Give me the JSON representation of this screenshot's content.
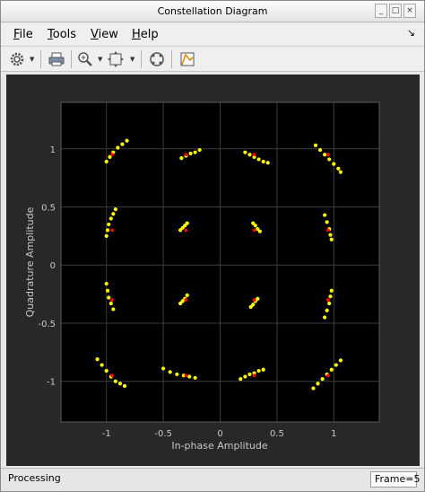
{
  "window": {
    "title": "Constellation Diagram"
  },
  "menu": {
    "items": [
      {
        "label": "File",
        "underline": "F",
        "rest": "ile"
      },
      {
        "label": "Tools",
        "underline": "T",
        "rest": "ools"
      },
      {
        "label": "View",
        "underline": "V",
        "rest": "iew"
      },
      {
        "label": "Help",
        "underline": "H",
        "rest": "elp"
      }
    ]
  },
  "toolbar": {
    "icons": [
      "gear-icon",
      "print-icon",
      "zoom-in-icon",
      "fit-view-icon",
      "constellation-icon",
      "measurement-icon"
    ]
  },
  "status": {
    "text": "Processing",
    "frame": "Frame=5"
  },
  "chart_data": {
    "type": "scatter",
    "title": "",
    "xlabel": "In-phase Amplitude",
    "ylabel": "Quadrature Amplitude",
    "xlim": [
      -1.4,
      1.4
    ],
    "ylim": [
      -1.35,
      1.4
    ],
    "xticks": [
      -1,
      -0.5,
      0,
      0.5,
      1
    ],
    "xtick_labels": [
      "-1",
      "-0.5",
      "0",
      "0.5",
      "1"
    ],
    "yticks": [
      -1,
      -0.5,
      0,
      0.5,
      1
    ],
    "ytick_labels": [
      "-1",
      "-0.5",
      "0",
      "0.5",
      "1"
    ],
    "grid": true,
    "colors": {
      "received": "#ffff00",
      "reference": "#ff0000",
      "plot_bg": "#000000"
    },
    "series": [
      {
        "values": [
          [
            -1.0,
            0.89
          ],
          [
            -0.97,
            0.93
          ],
          [
            -0.94,
            0.97
          ],
          [
            -0.9,
            1.01
          ],
          [
            -0.86,
            1.04
          ],
          [
            -0.82,
            1.07
          ],
          [
            -0.34,
            0.92
          ],
          [
            -0.3,
            0.94
          ],
          [
            -0.26,
            0.96
          ],
          [
            -0.22,
            0.97
          ],
          [
            -0.18,
            0.99
          ],
          [
            0.22,
            0.97
          ],
          [
            0.26,
            0.95
          ],
          [
            0.3,
            0.93
          ],
          [
            0.34,
            0.91
          ],
          [
            0.38,
            0.89
          ],
          [
            0.42,
            0.88
          ],
          [
            0.84,
            1.03
          ],
          [
            0.88,
            0.99
          ],
          [
            0.92,
            0.95
          ],
          [
            0.96,
            0.91
          ],
          [
            1.0,
            0.87
          ],
          [
            1.04,
            0.83
          ],
          [
            1.06,
            0.8
          ],
          [
            -1.0,
            0.25
          ],
          [
            -0.99,
            0.3
          ],
          [
            -0.98,
            0.35
          ],
          [
            -0.96,
            0.4
          ],
          [
            -0.94,
            0.44
          ],
          [
            -0.92,
            0.48
          ],
          [
            -0.35,
            0.3
          ],
          [
            -0.33,
            0.32
          ],
          [
            -0.31,
            0.34
          ],
          [
            -0.29,
            0.36
          ],
          [
            0.29,
            0.36
          ],
          [
            0.31,
            0.34
          ],
          [
            0.33,
            0.31
          ],
          [
            0.35,
            0.29
          ],
          [
            0.92,
            0.43
          ],
          [
            0.94,
            0.37
          ],
          [
            0.96,
            0.31
          ],
          [
            0.97,
            0.26
          ],
          [
            0.98,
            0.22
          ],
          [
            -1.0,
            -0.16
          ],
          [
            -0.99,
            -0.22
          ],
          [
            -0.98,
            -0.28
          ],
          [
            -0.96,
            -0.33
          ],
          [
            -0.94,
            -0.38
          ],
          [
            -0.35,
            -0.33
          ],
          [
            -0.33,
            -0.31
          ],
          [
            -0.31,
            -0.29
          ],
          [
            -0.29,
            -0.26
          ],
          [
            0.27,
            -0.36
          ],
          [
            0.29,
            -0.34
          ],
          [
            0.31,
            -0.31
          ],
          [
            0.33,
            -0.29
          ],
          [
            0.92,
            -0.45
          ],
          [
            0.94,
            -0.39
          ],
          [
            0.96,
            -0.33
          ],
          [
            0.97,
            -0.27
          ],
          [
            0.98,
            -0.22
          ],
          [
            -1.08,
            -0.81
          ],
          [
            -1.04,
            -0.86
          ],
          [
            -1.0,
            -0.91
          ],
          [
            -0.96,
            -0.96
          ],
          [
            -0.92,
            -1.0
          ],
          [
            -0.88,
            -1.02
          ],
          [
            -0.84,
            -1.04
          ],
          [
            -0.5,
            -0.89
          ],
          [
            -0.44,
            -0.92
          ],
          [
            -0.38,
            -0.94
          ],
          [
            -0.32,
            -0.95
          ],
          [
            -0.27,
            -0.96
          ],
          [
            -0.22,
            -0.97
          ],
          [
            0.18,
            -0.98
          ],
          [
            0.22,
            -0.96
          ],
          [
            0.26,
            -0.94
          ],
          [
            0.3,
            -0.93
          ],
          [
            0.34,
            -0.91
          ],
          [
            0.38,
            -0.9
          ],
          [
            0.82,
            -1.06
          ],
          [
            0.86,
            -1.02
          ],
          [
            0.9,
            -0.98
          ],
          [
            0.94,
            -0.94
          ],
          [
            0.98,
            -0.9
          ],
          [
            1.02,
            -0.86
          ],
          [
            1.06,
            -0.82
          ]
        ]
      },
      {
        "values": [
          [
            -0.95,
            0.95
          ],
          [
            -0.3,
            0.95
          ],
          [
            0.3,
            0.95
          ],
          [
            0.95,
            0.95
          ],
          [
            -0.95,
            0.3
          ],
          [
            -0.3,
            0.3
          ],
          [
            0.3,
            0.3
          ],
          [
            0.95,
            0.3
          ],
          [
            -0.95,
            -0.3
          ],
          [
            -0.3,
            -0.3
          ],
          [
            0.3,
            -0.3
          ],
          [
            0.95,
            -0.3
          ],
          [
            -0.95,
            -0.95
          ],
          [
            -0.3,
            -0.95
          ],
          [
            0.3,
            -0.95
          ],
          [
            0.95,
            -0.95
          ]
        ]
      }
    ]
  }
}
